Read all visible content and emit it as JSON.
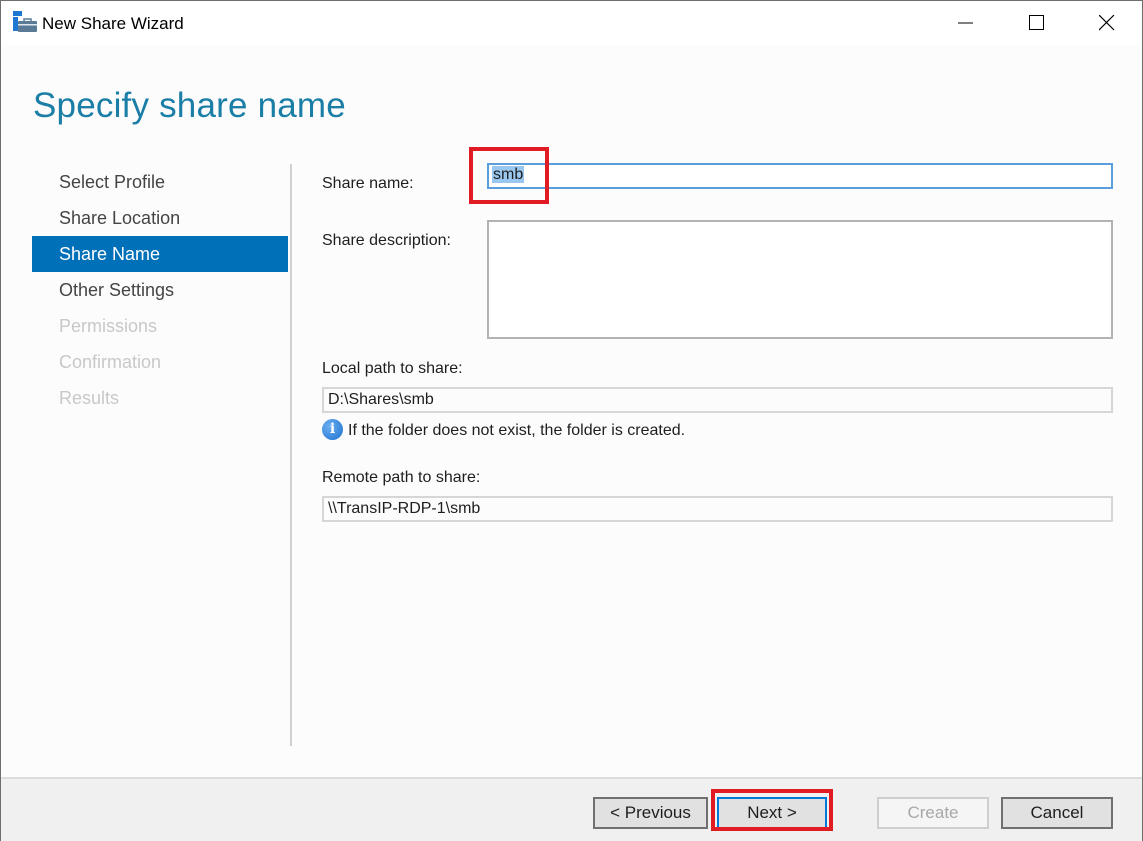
{
  "window": {
    "title": "New Share Wizard",
    "controls": {
      "minimize": "minimize",
      "maximize": "maximize",
      "close": "close"
    }
  },
  "page": {
    "heading": "Specify share name"
  },
  "nav": {
    "items": [
      {
        "label": "Select Profile",
        "state": "enabled"
      },
      {
        "label": "Share Location",
        "state": "enabled"
      },
      {
        "label": "Share Name",
        "state": "active"
      },
      {
        "label": "Other Settings",
        "state": "enabled"
      },
      {
        "label": "Permissions",
        "state": "disabled"
      },
      {
        "label": "Confirmation",
        "state": "disabled"
      },
      {
        "label": "Results",
        "state": "disabled"
      }
    ]
  },
  "form": {
    "share_name_label": "Share name:",
    "share_name_value": "smb",
    "share_description_label": "Share description:",
    "share_description_value": "",
    "local_path_label": "Local path to share:",
    "local_path_value": "D:\\Shares\\smb",
    "info_text": "If the folder does not exist, the folder is created.",
    "remote_path_label": "Remote path to share:",
    "remote_path_value": "\\\\TransIP-RDP-1\\smb"
  },
  "footer": {
    "previous_label": "< Previous",
    "next_label": "Next >",
    "create_label": "Create",
    "cancel_label": "Cancel"
  },
  "colors": {
    "accent": "#0070b8",
    "heading": "#1a7ea6",
    "highlight_annotation": "#e01b24"
  }
}
